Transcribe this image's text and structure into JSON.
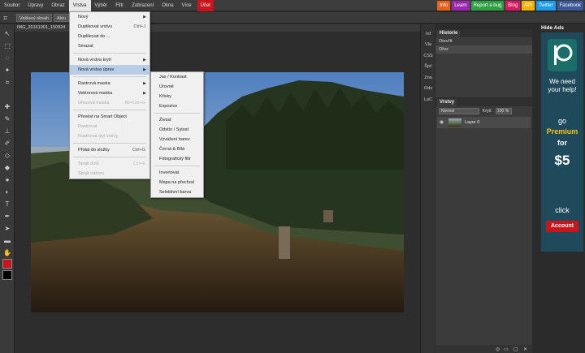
{
  "menubar": {
    "items": [
      "Soubor",
      "Úpravy",
      "Obraz",
      "Vrstva",
      "Výběr",
      "Filtr",
      "Zobrazení",
      "Okna",
      "Více"
    ],
    "account": "Účet",
    "badges": [
      {
        "label": "Info",
        "color": "#e8611a"
      },
      {
        "label": "Learn",
        "color": "#9b27af"
      },
      {
        "label": "Report a bug",
        "color": "#2ea043"
      },
      {
        "label": "Blog",
        "color": "#d81b60"
      },
      {
        "label": "API",
        "color": "#f0b400"
      },
      {
        "label": "Twitter",
        "color": "#1d9bf0"
      },
      {
        "label": "Facebook",
        "color": "#3b5998"
      }
    ]
  },
  "optbar": {
    "btn1": "Veškerý obsah",
    "btn2": "Aktu"
  },
  "document": {
    "title": "IMG_20161001_150924"
  },
  "sidestrip": [
    "Inf",
    "Vla",
    "CSS",
    "Špč",
    "Zna",
    "Ods",
    "LaC"
  ],
  "history": {
    "title": "Historie",
    "items": [
      "Otevřít",
      "Ořez"
    ]
  },
  "layers": {
    "title": "Vrstvy",
    "blend": "Normal",
    "opacity_label": "Krytí:",
    "opacity_value": "100 %",
    "layer_name": "Layer 0"
  },
  "ads": {
    "hide": "Hide Ads",
    "line1": "We need",
    "line2": "your help!",
    "line3": "go",
    "premium": "Premium",
    "for": "for",
    "price": "$5",
    "click": "click",
    "account": "Account"
  },
  "layer_menu": {
    "items": [
      {
        "label": "Nový",
        "arrow": "▶"
      },
      {
        "label": "Duplikovat vrstvu",
        "shortcut": "Ctrl+J"
      },
      {
        "label": "Duplikovat do ..."
      },
      {
        "label": "Smazat"
      },
      {
        "label": "Nová vrstva krytí",
        "arrow": "▶"
      },
      {
        "label": "Nová vrstva úprav",
        "arrow": "▶"
      },
      {
        "label": "Rastrová maska",
        "arrow": "▶"
      },
      {
        "label": "Vektorová maska",
        "arrow": "▶"
      },
      {
        "label": "Ořezová maska",
        "shortcut": "Alt+Ctrl+G"
      },
      {
        "label": "Převést na Smart Object"
      },
      {
        "label": "Rastrovat"
      },
      {
        "label": "Rastrovat styl vrstvy"
      },
      {
        "label": "Přidat do složky",
        "shortcut": "Ctrl+G"
      },
      {
        "label": "Spojit dolů",
        "shortcut": "Ctrl+E"
      },
      {
        "label": "Spojit nahoru"
      }
    ]
  },
  "adjust_menu": {
    "items": [
      "Jas / Kontrast",
      "Úrovně",
      "Křivky",
      "Expozice",
      "Živost",
      "Odstín / Sytost",
      "Vyvážení barev",
      "Černá & Bílá",
      "Fotografický filtr",
      "Invertovat",
      "Mapa na přechod",
      "Selektivní barva"
    ]
  }
}
